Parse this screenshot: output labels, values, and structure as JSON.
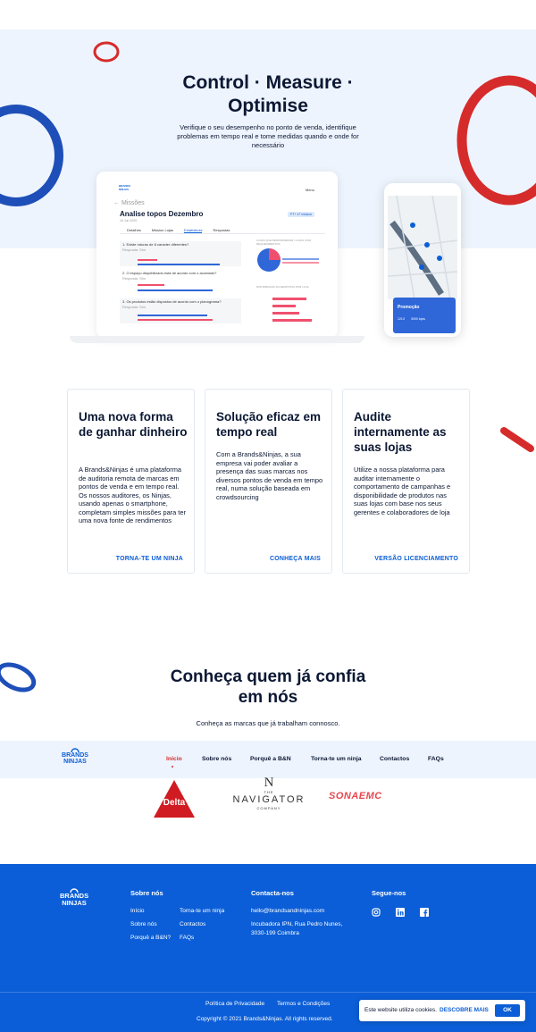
{
  "hero": {
    "title_line1": "Control · Measure ·",
    "title_line2": "Optimise",
    "subtitle": "Verifique o seu desempenho no ponto de venda, identifique problemas em tempo real e tome medidas quando e onde for necessário"
  },
  "laptop": {
    "logo": "BRANDS NINJAS",
    "menu": "Menu",
    "back": "← Missões",
    "title": "Analise topos Dezembro",
    "date": "16 Jun 2020",
    "badge": "PT+ 47 mission",
    "tabs": [
      "Detalhes",
      "Mission Lojas",
      "Estatísticas",
      "Respostas"
    ],
    "questions": [
      "1. Existe ruturas de 8 caracter diferentes?",
      "2. O espaço dispobilizado está de acordo com o acordado?",
      "3. Os produtos estão dispostos de acordo com o planograma?"
    ],
    "q_answer": "Resposta: Sim",
    "pie_title": "LOJAS QUE RESPONDERAM / LOJAS COM REQUERIMENTOS",
    "bars_title": "DISTRIBUIÇÃO DA RESPOSTA POR LOJA"
  },
  "phone": {
    "label": "Promoção",
    "chips": [
      "1213",
      "3000 lojas"
    ]
  },
  "cards": [
    {
      "title": "Uma nova forma de ganhar dinheiro",
      "text": "A Brands&Ninjas é uma plataforma de auditoria remota de marcas em pontos de venda e em tempo real. Os nossos auditores, os Ninjas, usando apenas o smartphone, completam simples missões para ter uma nova fonte de rendimentos",
      "link": "TORNA-TE UM NINJA"
    },
    {
      "title": "Solução eficaz em tempo real",
      "text": "Com a Brands&Ninjas, a sua empresa vai poder avaliar a presença das suas marcas nos diversos pontos de venda em tempo real, numa solução baseada em crowdsourcing",
      "link": "CONHEÇA MAIS"
    },
    {
      "title": "Audite internamente as suas lojas",
      "text": "Utilize a nossa plataforma para auditar internamente o comportamento de campanhas e disponibilidade de produtos nas suas lojas com base nos seus gerentes e colaboradores de loja",
      "link": "VERSÃO LICENCIAMENTO"
    }
  ],
  "trust": {
    "title_line1": "Conheça quem já confia",
    "title_line2": "em nós",
    "subtitle": "Conheça as marcas que já trabalham connosco."
  },
  "nav": {
    "logo_top": "BRANDS",
    "logo_bottom": "NINJAS",
    "items": [
      "Início",
      "Sobre nós",
      "Porquê a B&N",
      "Torna-te um ninja",
      "Contactos",
      "FAQs"
    ]
  },
  "brands": {
    "delta": "Delta",
    "navigator_n": "N",
    "navigator_the": "THE",
    "navigator": "NAVIGATOR",
    "navigator_company": "COMPANY",
    "sonae": "SONAEMC"
  },
  "footer": {
    "logo_top": "BRANDS",
    "logo_bottom": "NINJAS",
    "about_title": "Sobre nós",
    "about_links": [
      "Início",
      "Sobre nós",
      "Porquê a B&N?"
    ],
    "more_links": [
      "Torna-te um ninja",
      "Contactos",
      "FAQs"
    ],
    "contact_title": "Contacta-nos",
    "email": "hello@brandsandninjas.com",
    "address_line1": "Incubadora IPN, Rua Pedro Nunes,",
    "address_line2": "3030-199 Coimbra",
    "follow_title": "Segue-nos",
    "privacy": "Política de Privacidade",
    "terms": "Termos e Condições",
    "copyright": "Copyright © 2021 Brands&Ninjas. All rights reserved."
  },
  "cookie": {
    "text": "Este website utiliza cookies.",
    "link": "DESCOBRE MAIS",
    "ok": "OK"
  },
  "colors": {
    "brand_blue": "#0b5ed7",
    "navy": "#0c1833",
    "accent_red": "#d62b2b",
    "hero_bg": "#eef4fd",
    "pink": "#f0506e"
  }
}
